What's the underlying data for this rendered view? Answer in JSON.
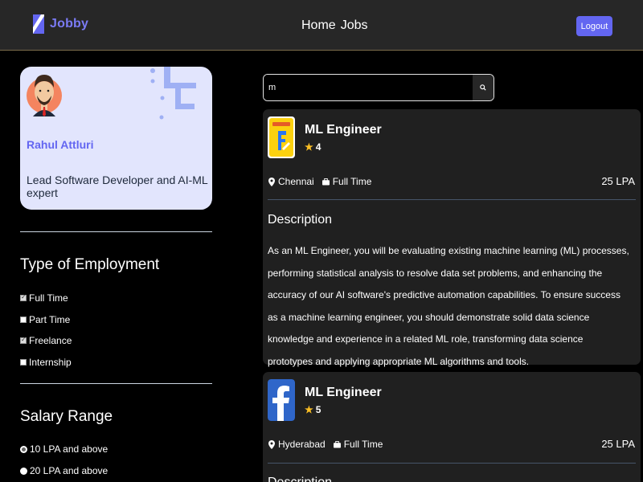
{
  "header": {
    "brand": "Jobby",
    "nav": [
      "Home",
      "Jobs"
    ],
    "logout_label": "Logout",
    "colors": {
      "accent": "#6366f1",
      "bg": "#272727"
    }
  },
  "profile": {
    "name": "Rahul Attluri",
    "bio": "Lead Software Developer and AI-ML expert",
    "avatar_icon": "avatar-icon"
  },
  "filters": {
    "employment": {
      "title": "Type of Employment",
      "options": [
        {
          "label": "Full Time",
          "checked": true
        },
        {
          "label": "Part Time",
          "checked": false
        },
        {
          "label": "Freelance",
          "checked": true
        },
        {
          "label": "Internship",
          "checked": false
        }
      ]
    },
    "salary": {
      "title": "Salary Range",
      "options": [
        {
          "label": "10 LPA and above",
          "selected": true
        },
        {
          "label": "20 LPA and above",
          "selected": false
        }
      ]
    }
  },
  "search": {
    "value": "m",
    "icon": "search-icon"
  },
  "jobs": [
    {
      "title": "ML Engineer",
      "rating": "4",
      "location": "Chennai",
      "type": "Full Time",
      "package": "25 LPA",
      "desc_title": "Description",
      "description": "As an ML Engineer, you will be evaluating existing machine learning (ML) processes, performing statistical analysis to resolve data set problems, and enhancing the accuracy of our AI software's predictive automation capabilities. To ensure success as a machine learning engineer, you should demonstrate solid data science knowledge and experience in a related ML role, transforming data science prototypes and applying appropriate ML algorithms and tools.",
      "logo": "flipkart-logo"
    },
    {
      "title": "ML Engineer",
      "rating": "5",
      "location": "Hyderabad",
      "type": "Full Time",
      "package": "25 LPA",
      "desc_title": "Description",
      "logo": "facebook-logo"
    }
  ]
}
